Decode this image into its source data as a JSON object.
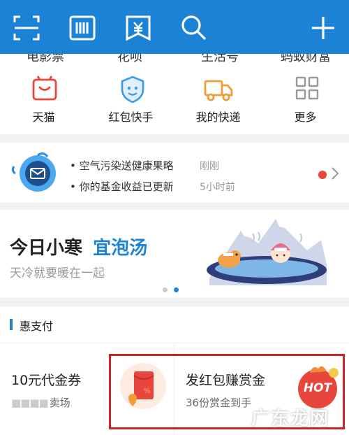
{
  "top_icons": [
    "scan-icon",
    "barcode-icon",
    "pay-code-icon",
    "search-icon",
    "plus-icon"
  ],
  "partial_row": [
    "电影票",
    "花呗",
    "生活号",
    "蚂蚁财富"
  ],
  "grid": [
    {
      "label": "天猫",
      "icon": "tmall-icon",
      "color": "#e8473c"
    },
    {
      "label": "红包快手",
      "icon": "redpacket-quickhand-icon",
      "color": "#3a9be6"
    },
    {
      "label": "我的快递",
      "icon": "delivery-truck-icon",
      "color": "#f29c38"
    },
    {
      "label": "更多",
      "icon": "more-grid-icon",
      "color": "#999999"
    }
  ],
  "notices": [
    {
      "text": "空气污染送健康果略",
      "time": "刚刚"
    },
    {
      "text": "你的基金收益已更新",
      "time": "5小时前"
    }
  ],
  "banner": {
    "title": "今日小寒",
    "highlight": "宜泡汤",
    "subtitle": "天冷就要暖在一起"
  },
  "section": {
    "title": "惠支付",
    "card_left": {
      "title": "10元代金券",
      "subtitle": "卖场",
      "blurred_prefix": "■■■■"
    },
    "card_right": {
      "title": "发红包赚赏金",
      "subtitle": "36份赏金到手",
      "badge": "HOT"
    }
  },
  "watermark": "广东龙网",
  "colors": {
    "brand_blue": "#1b82d6",
    "accent_red": "#e8453c",
    "highlight_blue": "#1b82d6"
  }
}
